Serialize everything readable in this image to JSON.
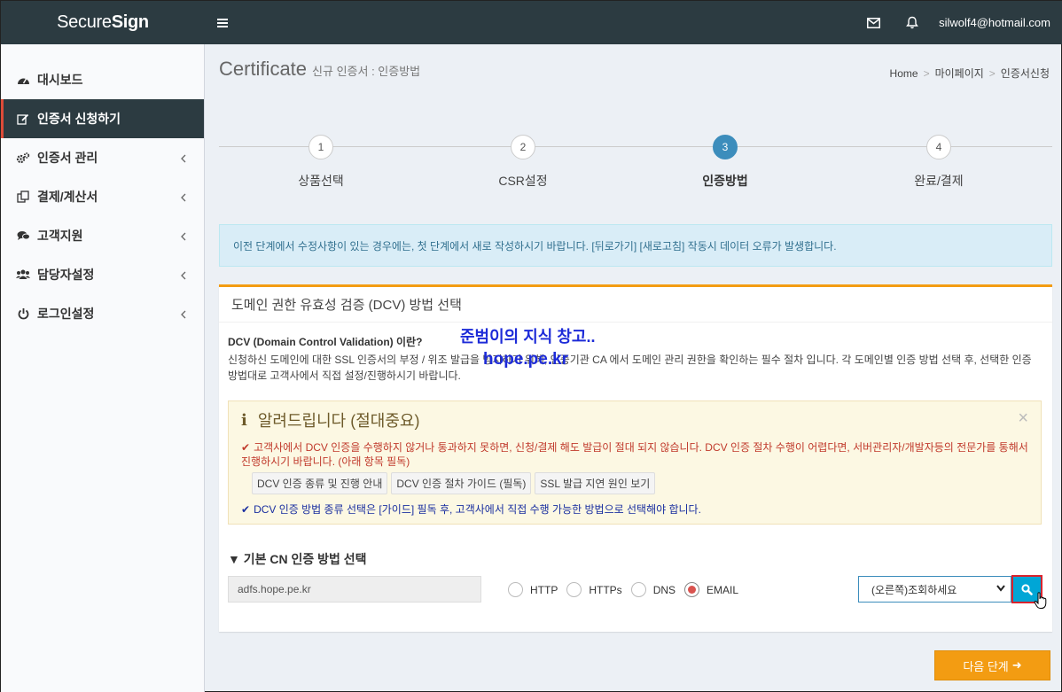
{
  "header": {
    "logo_light": "Secure",
    "logo_bold": "Sign",
    "user_email": "silwolf4@hotmail.com"
  },
  "sidebar": {
    "items": [
      {
        "label": "대시보드",
        "icon": "dashboard-icon"
      },
      {
        "label": "인증서 신청하기",
        "icon": "edit-icon",
        "active": true
      },
      {
        "label": "인증서 관리",
        "icon": "cogs-icon"
      },
      {
        "label": "결제/계산서",
        "icon": "copy-icon"
      },
      {
        "label": "고객지원",
        "icon": "comments-icon"
      },
      {
        "label": "담당자설정",
        "icon": "users-icon"
      },
      {
        "label": "로그인설정",
        "icon": "power-icon"
      }
    ]
  },
  "page": {
    "title": "Certificate",
    "subtitle": "신규 인증서 : 인증방법",
    "breadcrumb": [
      "Home",
      "마이페이지",
      "인증서신청"
    ]
  },
  "stepper": {
    "active_step": 3,
    "steps": [
      {
        "number": "1",
        "label": "상품선택"
      },
      {
        "number": "2",
        "label": "CSR설정"
      },
      {
        "number": "3",
        "label": "인증방법"
      },
      {
        "number": "4",
        "label": "완료/결제"
      }
    ]
  },
  "callout": {
    "text": "이전 단계에서 수정사항이 있는 경우에는, 첫 단계에서 새로 작성하시기 바랍니다. [뒤로가기] [새로고침] 작동시 데이터 오류가 발생합니다."
  },
  "dcv": {
    "box_title": "도메인 권한 유효성 검증 (DCV) 방법 선택",
    "question": "DCV (Domain Control Validation) 이란?",
    "description": "신청하신 도메인에 대한 SSL 인증서의 부정 / 위조 발급을 방지하기 위해, 인증기관 CA 에서 도메인 관리 권한을 확인하는 필수 절차 입니다. 각 도메인별 인증 방법 선택 후, 선택한 인증 방법대로 고객사에서 직접 설정/진행하시기 바랍니다.",
    "watermark_line1": "준범이의 지식 창고..",
    "watermark_line2": "hope.pe.kr"
  },
  "notice": {
    "title": "알려드립니다 (절대중요)",
    "red_text": "고객사에서 DCV 인증을 수행하지 않거나 통과하지 못하면, 신청/결제 해도 발급이 절대 되지 않습니다. DCV 인증 절차 수행이 어렵다면, 서버관리자/개발자등의 전문가를 통해서 진행하시기 바랍니다. (아래 항목 필독)",
    "buttons": [
      "DCV 인증 종류 및 진행 안내",
      "DCV 인증 절차 가이드 (필독)",
      "SSL 발급 지연 원인 보기"
    ],
    "blue_text": "DCV 인증 방법 종류 선택은 [가이드] 필독 후, 고객사에서 직접 수행 가능한 방법으로 선택해야 합니다.",
    "close": "×"
  },
  "cn": {
    "title": "▼ 기본 CN 인증 방법 선택",
    "domain": "adfs.hope.pe.kr",
    "methods": [
      "HTTP",
      "HTTPs",
      "DNS",
      "EMAIL"
    ],
    "selected_method": "EMAIL",
    "select_value": "(오른쪽)조회하세요"
  },
  "footer": {
    "next_label": "다음 단계"
  },
  "colors": {
    "topbar": "#2c3b41",
    "accent_blue": "#3c8dbc",
    "warning_orange": "#f39c12",
    "active_border": "#dd4b39"
  }
}
